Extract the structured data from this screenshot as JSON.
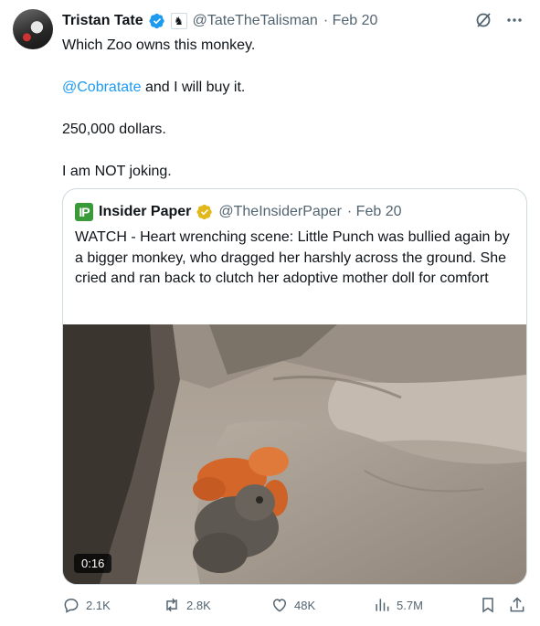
{
  "tweet": {
    "author_name": "Tristan Tate",
    "handle": "@TateTheTalisman",
    "date": "· Feb 20",
    "line1": "Which Zoo owns this monkey.",
    "mention": "@Cobratate",
    "line2_rest": " and I will buy it.",
    "line3": "250,000 dollars.",
    "line4": "I am NOT joking."
  },
  "quote": {
    "logo_text": "IP",
    "author_name": "Insider Paper",
    "handle": "@TheInsiderPaper",
    "date": "· Feb 20",
    "text": "WATCH - Heart wrenching scene: Little Punch was bullied again by a bigger monkey, who dragged her harshly across the ground. She cried and ran back to clutch her adoptive mother doll for comfort",
    "video_duration": "0:16"
  },
  "actions": {
    "replies": "2.1K",
    "reposts": "2.8K",
    "likes": "48K",
    "views": "5.7M"
  },
  "colors": {
    "verified_blue": "#1d9bf0",
    "verified_gold": "#e2b719",
    "muted": "#536471",
    "link": "#1d9bf0"
  },
  "icons": [
    "verified-badge-icon",
    "chess-knight-icon",
    "grok-icon",
    "more-icon",
    "reply-icon",
    "repost-icon",
    "like-icon",
    "views-icon",
    "bookmark-icon",
    "share-icon"
  ]
}
